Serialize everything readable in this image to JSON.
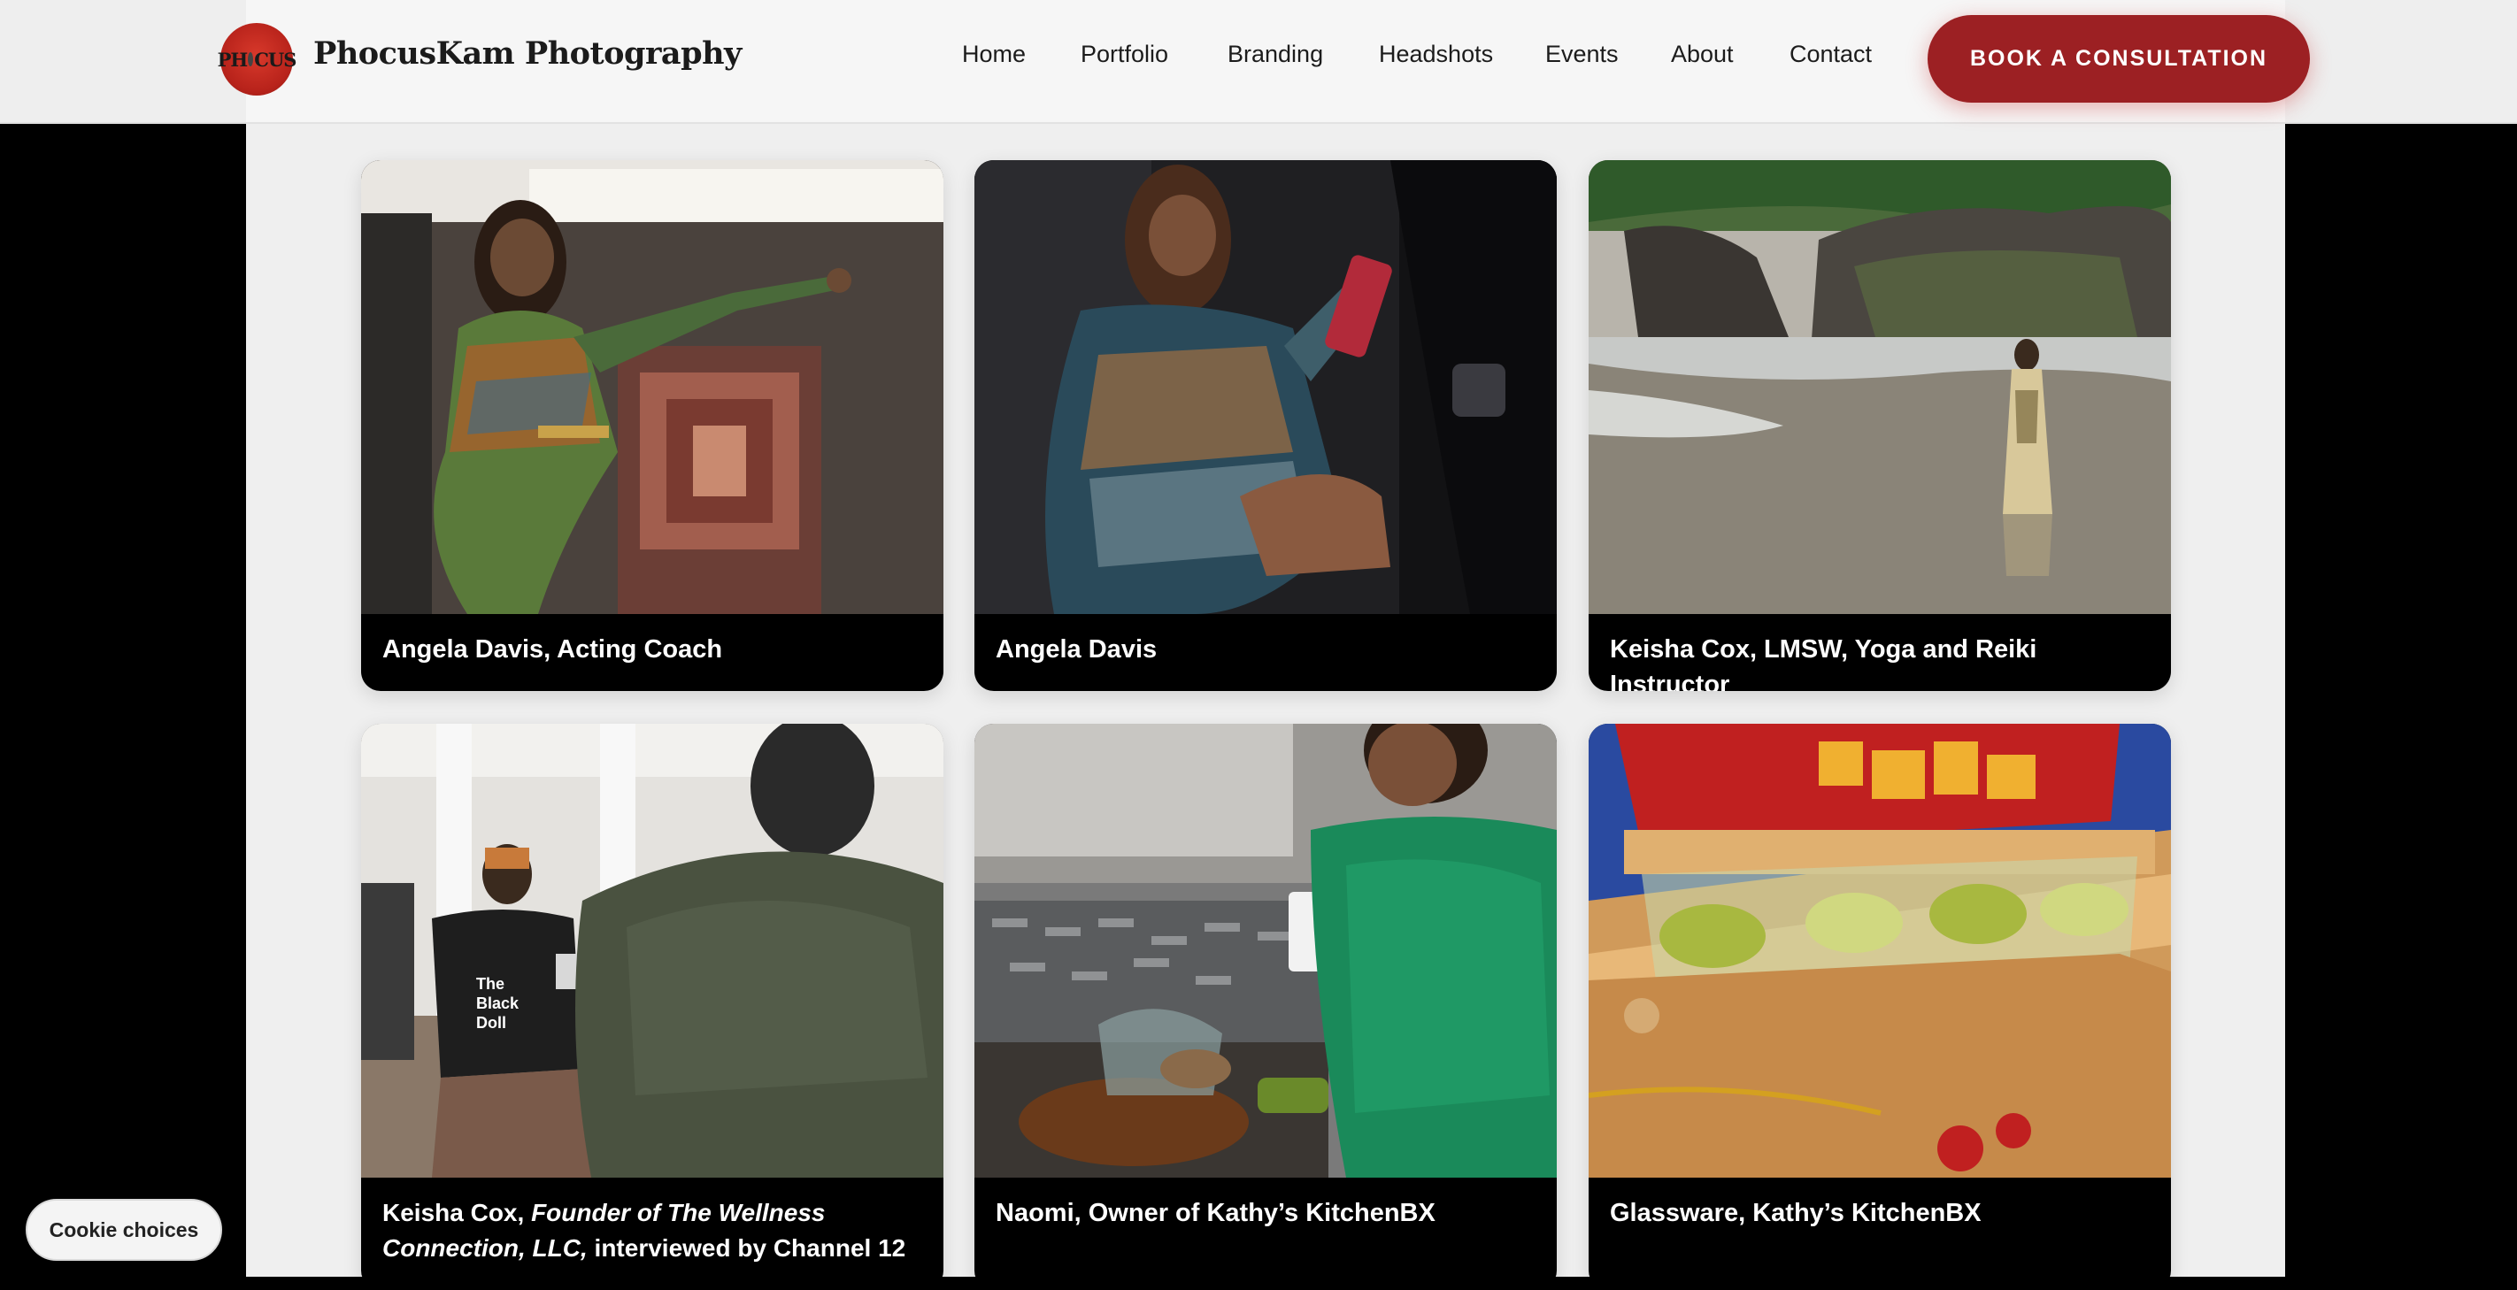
{
  "header": {
    "brand": "PhocusKam Photography",
    "logo_text": "PHOCUS",
    "nav": [
      "Home",
      "Portfolio",
      "Branding",
      "Headshots",
      "Events",
      "About",
      "Contact"
    ],
    "cta_label": "BOOK A CONSULTATION"
  },
  "gallery": [
    {
      "caption": "Angela Davis, Acting Coach"
    },
    {
      "caption": "Angela Davis"
    },
    {
      "caption": "Keisha Cox, LMSW, Yoga and Reiki Instructor"
    },
    {
      "caption_pre": "Keisha Cox, ",
      "caption_em": "Founder of The Wellness Connection, LLC,",
      "caption_post": " interviewed by Channel 12"
    },
    {
      "caption": "Naomi, Owner of Kathy’s KitchenBX"
    },
    {
      "caption": "Glassware, Kathy’s KitchenBX"
    }
  ],
  "cookie_label": "Cookie choices",
  "colors": {
    "accent": "#9c2023",
    "page_bg": "#efefef",
    "outer_bg": "#000000"
  }
}
